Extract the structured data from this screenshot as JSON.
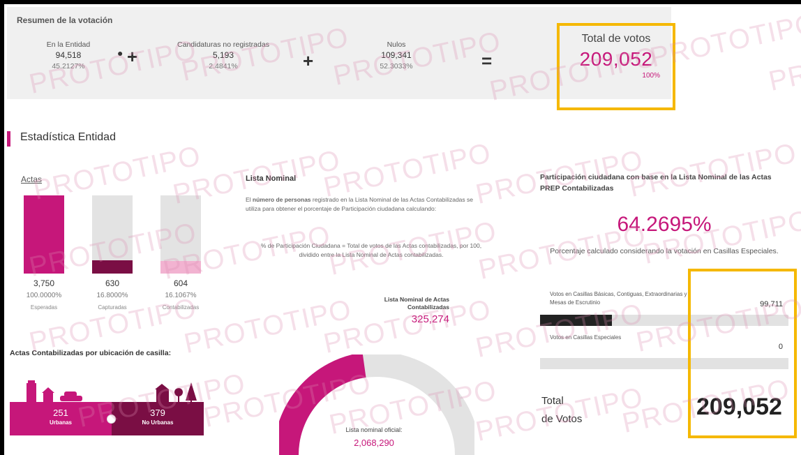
{
  "summary": {
    "title": "Resumen de la votación",
    "en_entidad": {
      "label": "En la Entidad",
      "value": "94,518",
      "pct": "45.2127%"
    },
    "no_registradas": {
      "label": "Candidaturas no registradas",
      "value": "5,193",
      "pct": "2.4841%"
    },
    "nulos": {
      "label": "Nulos",
      "value": "109,341",
      "pct": "52.3033%"
    },
    "total": {
      "label": "Total de votos",
      "value": "209,052",
      "pct": "100%"
    },
    "op_plus": "+",
    "op_eq": "="
  },
  "stats": {
    "title": "Estadística Entidad",
    "actas_label": "Actas",
    "bars": [
      {
        "value": "3,750",
        "pct": "100.0000%",
        "label": "Esperadas",
        "fraction": 1.0,
        "color": "#c6177a"
      },
      {
        "value": "630",
        "pct": "16.8000%",
        "label": "Capturadas",
        "fraction": 0.168,
        "color": "#7a0e44"
      },
      {
        "value": "604",
        "pct": "16.1067%",
        "label": "Contabilizadas",
        "fraction": 0.161,
        "color": "#f2b3d1"
      }
    ]
  },
  "lista": {
    "title": "Lista Nominal",
    "text_pre": "El ",
    "text_bold": "número de personas",
    "text_post": " registrado en la Lista Nominal de las Actas Contabilizadas se utiliza para obtener el porcentaje de Participación ciudadana calculando:",
    "formula": "% de Participación Ciudadana = Total de votos de las Actas contabilizadas, por 100, dividido entre la Lista Nominal de Actas contabilizadas.",
    "nominal_label": "Lista Nominal de Actas Contabilizadas",
    "nominal_value": "325,274"
  },
  "participacion": {
    "title": "Participación ciudadana con base en la Lista Nominal de las Actas PREP Contabilizadas",
    "value": "64.2695%",
    "note": "Porcentaje calculado considerando la votación en Casillas Especiales.",
    "rows": [
      {
        "label": "Votos en Casillas Básicas, Contiguas, Extraordinarias y Mesas de Escrutinio",
        "value": "99,711",
        "fraction": 0.29
      },
      {
        "label": "Votos en Casillas Especiales",
        "value": "0",
        "fraction": 0.0
      }
    ],
    "total_label_1": "Total",
    "total_label_2": "de Votos",
    "total_value": "209,052"
  },
  "ubicacion": {
    "title": "Actas Contabilizadas por ubicación de casilla:",
    "urbanas": {
      "value": "251",
      "label": "Urbanas"
    },
    "no_urbanas": {
      "value": "379",
      "label": "No Urbanas"
    }
  },
  "donut": {
    "label": "Lista nominal oficial:",
    "value": "2,068,290"
  },
  "watermark": "PROTOTIPO",
  "colors": {
    "accent": "#c6177a",
    "dark_accent": "#7a0e44",
    "highlight": "#f5b800"
  }
}
